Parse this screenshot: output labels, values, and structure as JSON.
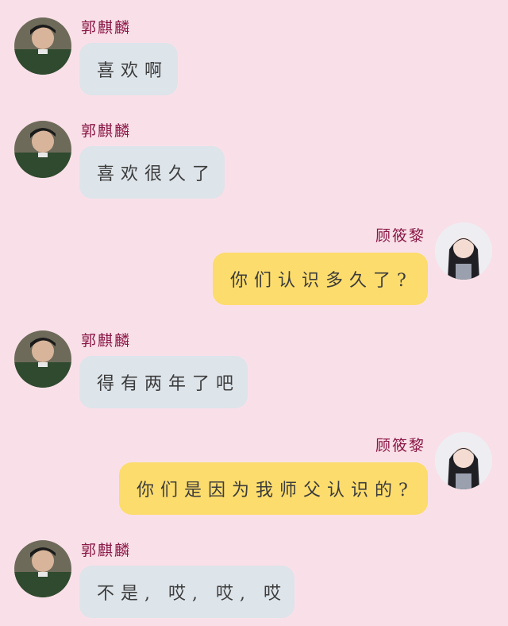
{
  "colors": {
    "background": "#f9e0e8",
    "left_bubble": "#dde4ea",
    "right_bubble": "#fcdc6c",
    "name": "#8a1745"
  },
  "messages": [
    {
      "side": "left",
      "sender": "郭麒麟",
      "text": "喜欢啊",
      "avatar": "male-avatar"
    },
    {
      "side": "left",
      "sender": "郭麒麟",
      "text": "喜欢很久了",
      "avatar": "male-avatar"
    },
    {
      "side": "right",
      "sender": "顾筱黎",
      "text": "你们认识多久了?",
      "avatar": "female-avatar"
    },
    {
      "side": "left",
      "sender": "郭麒麟",
      "text": "得有两年了吧",
      "avatar": "male-avatar"
    },
    {
      "side": "right",
      "sender": "顾筱黎",
      "text": "你们是因为我师父认识的?",
      "avatar": "female-avatar"
    },
    {
      "side": "left",
      "sender": "郭麒麟",
      "text": "不是, 哎, 哎, 哎",
      "avatar": "male-avatar"
    }
  ]
}
